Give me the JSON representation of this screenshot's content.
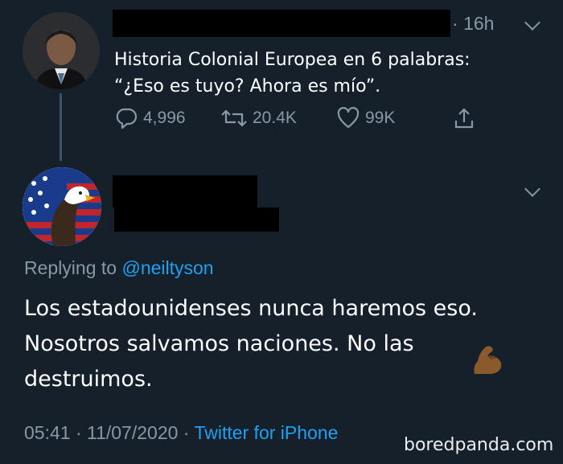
{
  "tweet": {
    "time_ago": "16h",
    "separator": "· ",
    "text_line1": "Historia Colonial Europea en 6 palabras:",
    "text_line2": "“¿Eso es tuyo? Ahora es mío”.",
    "replies": "4,996",
    "retweets": "20.4K",
    "likes": "99K"
  },
  "reply": {
    "replying_label": "Replying to ",
    "replying_handle": "@neiltyson",
    "line1": "Los estadounidenses nunca haremos eso.",
    "line2": "Nosotros salvamos naciones. No las",
    "line3": "destruimos.",
    "emoji": "flexed-biceps-icon",
    "time": "05:41 · 11/07/2020 · ",
    "source": "Twitter for iPhone"
  },
  "watermark": "boredpanda.com",
  "colors": {
    "background": "#15202b",
    "muted": "#8899a6",
    "link": "#1da1f2",
    "text": "#ffffff"
  }
}
